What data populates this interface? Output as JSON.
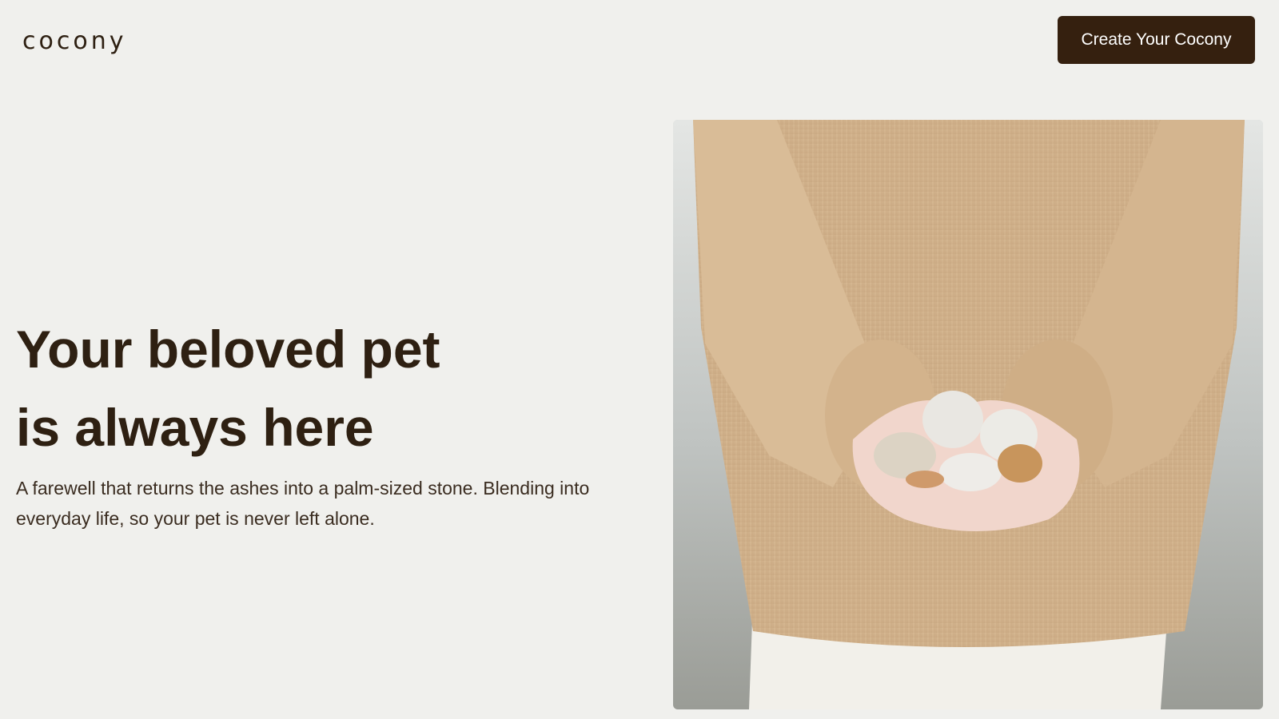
{
  "header": {
    "logo_text": "cocony",
    "cta_label": "Create Your Cocony"
  },
  "hero": {
    "title_line1": "Your beloved pet",
    "title_line2": "is always here",
    "subtitle": "A farewell that returns the ashes into a palm-sized stone. Blending into everyday life, so your pet is never left alone."
  },
  "colors": {
    "background": "#f0f0ed",
    "text": "#2e2012",
    "accent": "#35200f"
  },
  "image": {
    "subject": "person in knit sweater holding stones in cupped hands"
  }
}
